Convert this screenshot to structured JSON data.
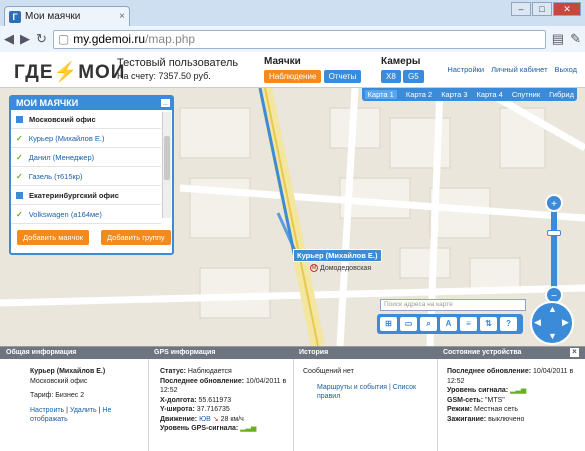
{
  "browser": {
    "tab_title": "Мои маячки",
    "url_host": "my.gdemoi.ru",
    "url_path": "/map.php"
  },
  "logo": {
    "text_left": "ГДЕ",
    "text_right": "МОИ"
  },
  "user": {
    "name": "Тестовый пользователь",
    "balance": "На счету: 7357.50 руб."
  },
  "beacons": {
    "title": "Маячки",
    "observe": "Наблюдение",
    "reports": "Отчеты"
  },
  "cameras": {
    "title": "Камеры",
    "x8": "X8",
    "g5": "G5"
  },
  "header_links": [
    "Настройки",
    "Личный кабинет",
    "Выход"
  ],
  "map_tabs": [
    "Карта 1",
    "Карта 2",
    "Карта 3",
    "Карта 4",
    "Спутник",
    "Гибрид"
  ],
  "panel": {
    "title": "МОИ МАЯЧКИ",
    "items": [
      {
        "type": "group",
        "label": "Московский офис"
      },
      {
        "type": "item",
        "label": "Курьер (Михайлов Е.)"
      },
      {
        "type": "item",
        "label": "Данил (Менеджер)"
      },
      {
        "type": "item",
        "label": "Газель (т615кр)"
      },
      {
        "type": "group",
        "label": "Екатеринбургский офис"
      },
      {
        "type": "item",
        "label": "Volkswagen (а164ме)"
      }
    ],
    "add_beacon": "Добавить маячок",
    "add_group": "Добавить группу"
  },
  "map": {
    "vehicle_label": "Курьер (Михайлов Е.)",
    "metro": "Домодедовская",
    "search_placeholder": "Поиск адреса на карте"
  },
  "info": {
    "headers": [
      "Общая информация",
      "GPS информация",
      "История",
      "Состояние устройства"
    ],
    "general": {
      "name": "Курьер (Михайлов Е.)",
      "office": "Московский офис",
      "tariff": "Тариф: Бизнес 2",
      "links": [
        "Настроить",
        "Удалить",
        "Не отображать"
      ]
    },
    "gps": {
      "status_label": "Статус:",
      "status": "Наблюдается",
      "updated_label": "Последнее обновление:",
      "updated": "10/04/2011 в 12:52",
      "x_label": "X-долгота:",
      "x": "55.611973",
      "y_label": "Y-широта:",
      "y": "37.716735",
      "move_label": "Движение:",
      "move_dir": "ЮВ",
      "move_speed": "28 км/ч",
      "signal_label": "Уровень GPS-сигнала:"
    },
    "history": {
      "text": "Сообщений нет",
      "links": "Маршруты и события | Список правил"
    },
    "device": {
      "updated_label": "Последнее обновление:",
      "updated": "10/04/2011 в 12:52",
      "signal_label": "Уровень сигнала:",
      "gsm_label": "GSM-сеть:",
      "gsm": "\"MTS\"",
      "mode_label": "Режим:",
      "mode": "Местная сеть",
      "ignition_label": "Зажигание:",
      "ignition": "выключено"
    }
  }
}
